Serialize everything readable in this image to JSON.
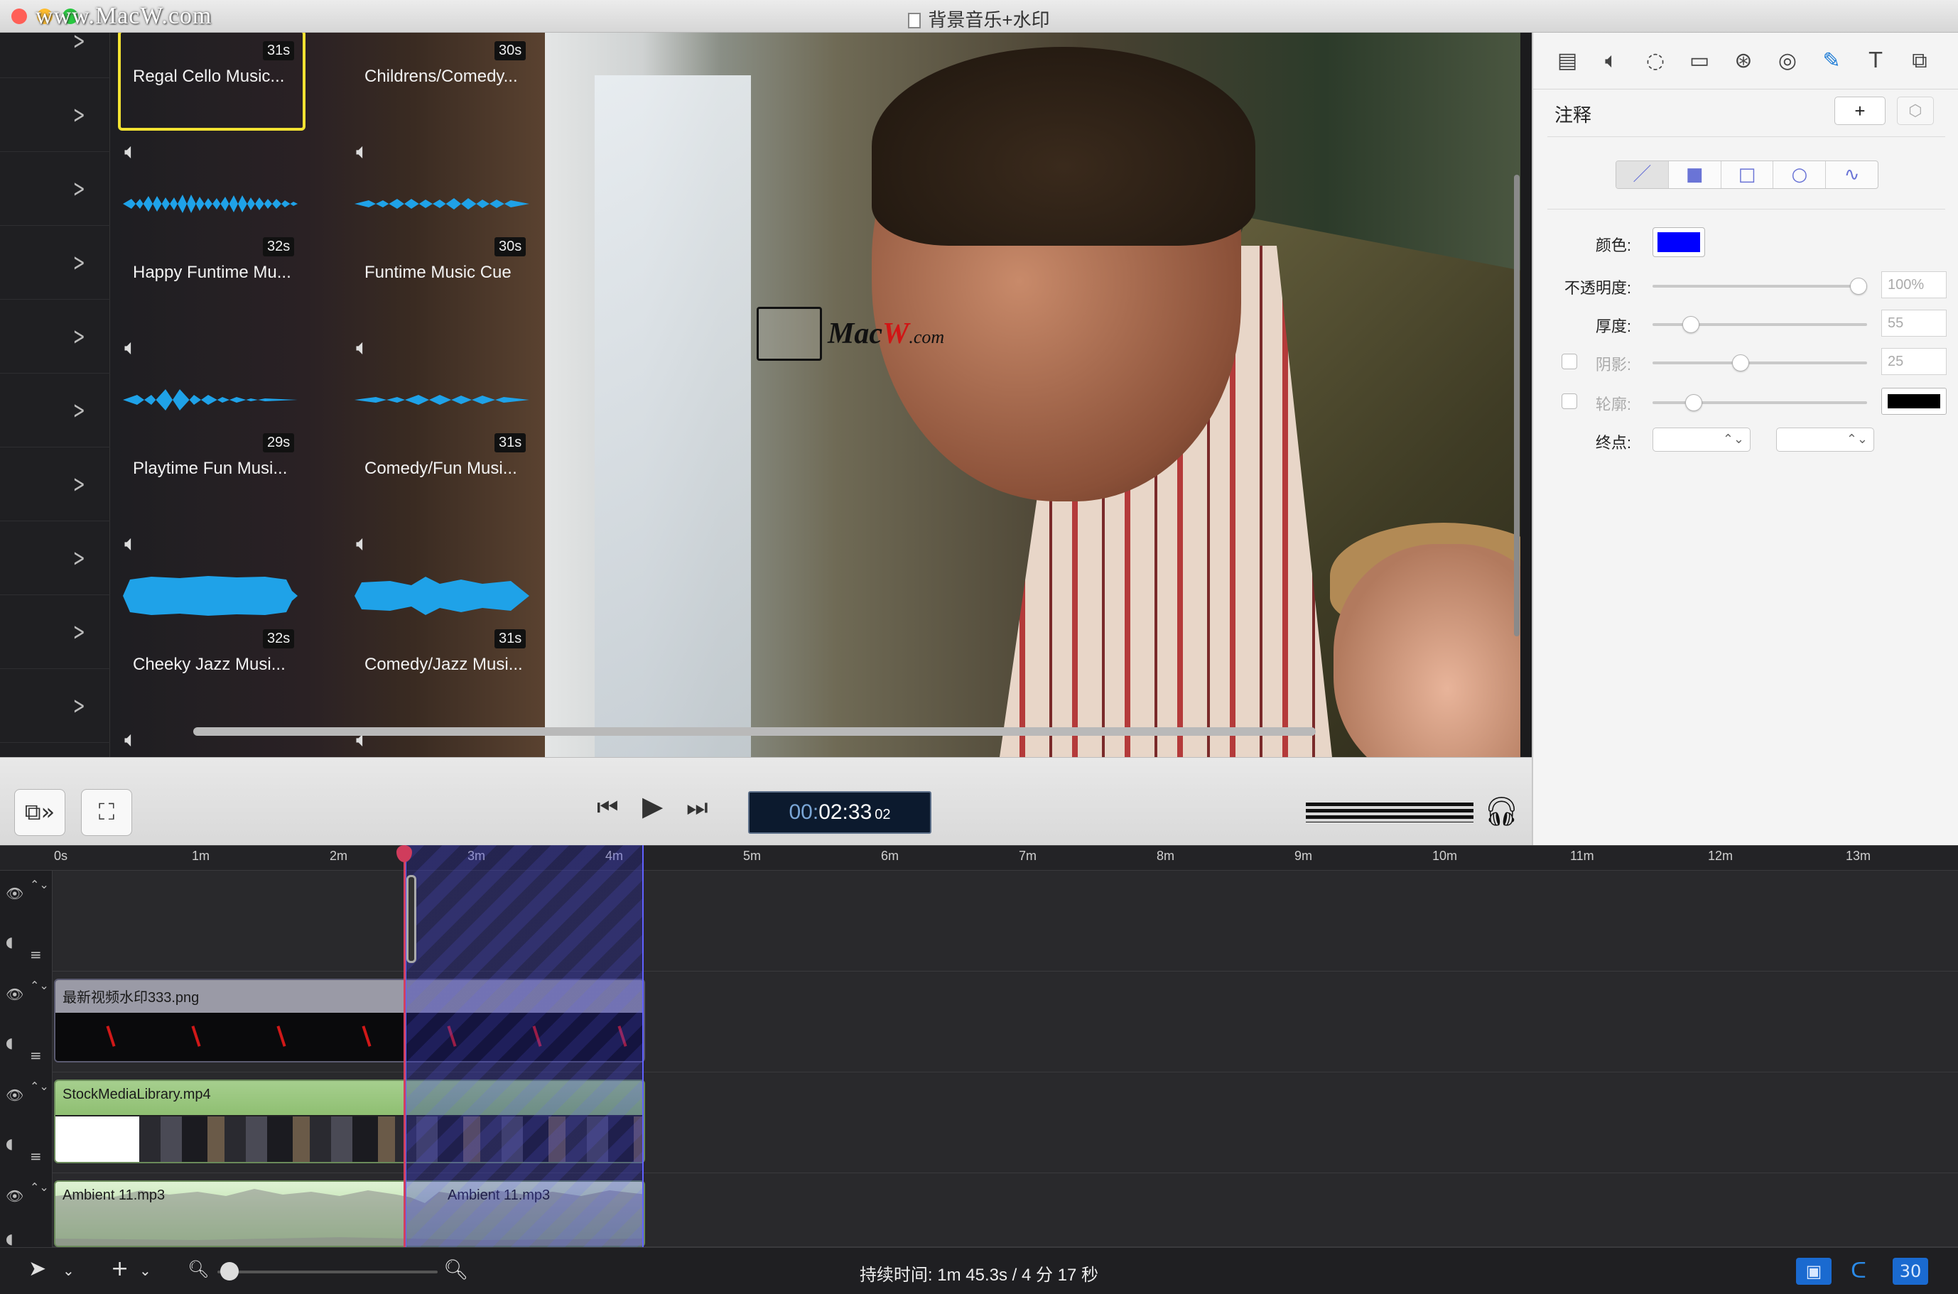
{
  "window": {
    "title": "背景音乐+水印",
    "watermark_top": "www.MacW.com"
  },
  "browser": {
    "tiles": [
      {
        "name": "Regal Cello Music...",
        "duration": "31s",
        "selected": true
      },
      {
        "name": "Childrens/Comedy...",
        "duration": "30s"
      },
      {
        "name": "Happy Funtime Mu...",
        "duration": "32s"
      },
      {
        "name": "Funtime Music Cue",
        "duration": "30s"
      },
      {
        "name": "Playtime Fun Musi...",
        "duration": "29s"
      },
      {
        "name": "Comedy/Fun Musi...",
        "duration": "31s"
      },
      {
        "name": "Cheeky Jazz Musi...",
        "duration": "32s"
      },
      {
        "name": "Comedy/Jazz Musi...",
        "duration": "31s"
      }
    ],
    "wave_color": "#1fa2e8"
  },
  "video_watermark": {
    "brand_a": "Mac",
    "brand_b": "W",
    "brand_c": ".com"
  },
  "transport": {
    "timecode_dim": "00:",
    "timecode_main": "02:33",
    "timecode_frames": "02",
    "prev_icon": "skip-back-icon",
    "play_icon": "play-icon",
    "next_icon": "skip-forward-icon"
  },
  "inspector": {
    "title": "注释",
    "add_label": "+",
    "tools": [
      "video-icon",
      "audio-icon",
      "speed-icon",
      "screen-icon",
      "cursor-icon",
      "filters-icon",
      "annotation-icon",
      "text-icon",
      "transform-icon"
    ],
    "active_tool": "annotation-icon",
    "shapes": [
      "／",
      "■",
      "□",
      "○",
      "∿"
    ],
    "color_label": "颜色:",
    "color": "#0000ff",
    "opacity_label": "不透明度:",
    "opacity_value": "100%",
    "thickness_label": "厚度:",
    "thickness_value": "55",
    "shadow_label": "阴影:",
    "shadow_value": "25",
    "outline_label": "轮廓:",
    "outline_color": "#000000",
    "endpoint_label": "终点:"
  },
  "timeline": {
    "ruler": [
      "0s",
      "1m",
      "2m",
      "3m",
      "4m",
      "5m",
      "6m",
      "7m",
      "8m",
      "9m",
      "10m",
      "11m",
      "12m",
      "13m"
    ],
    "tracks": [
      {
        "name": ""
      },
      {
        "name": "最新视频水印333.png"
      },
      {
        "name": "StockMediaLibrary.mp4"
      },
      {
        "name": "Ambient 11.mp3",
        "name2": "Ambient 11.mp3"
      }
    ]
  },
  "bottom": {
    "duration_label": "持续时间: 1m 45.3s  /  4 分 17 秒",
    "fps": "30"
  }
}
